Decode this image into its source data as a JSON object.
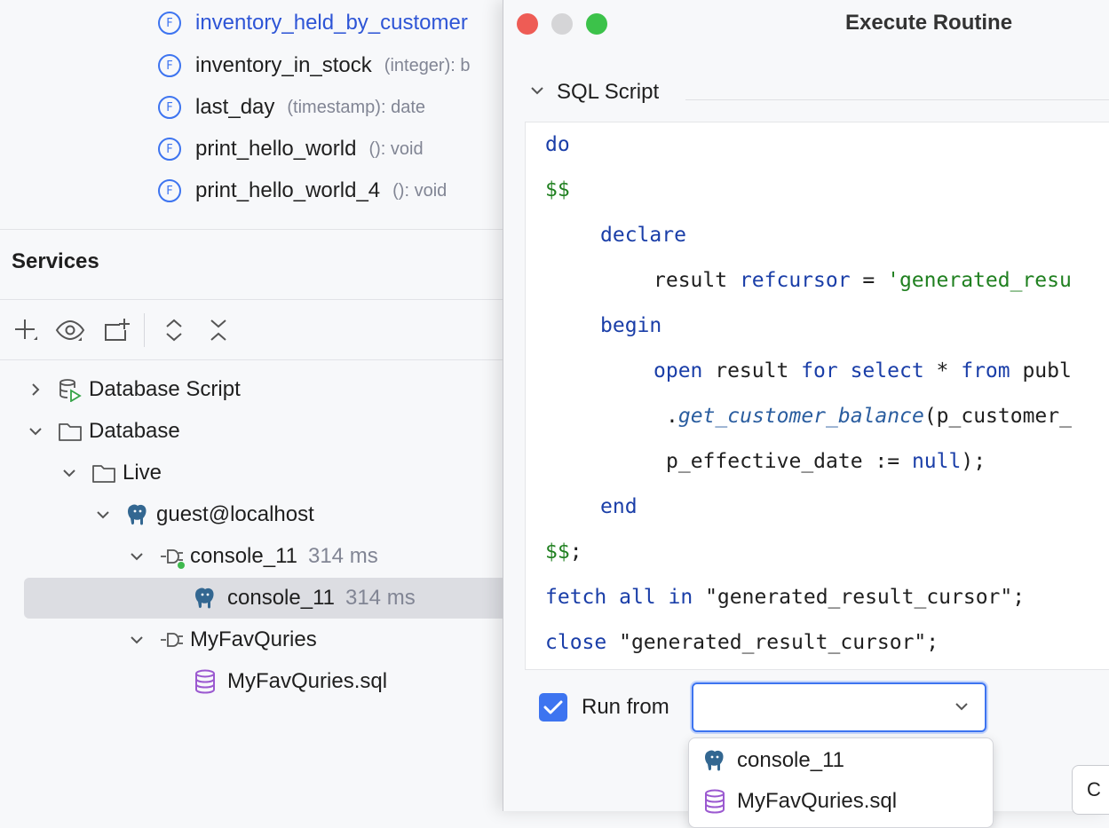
{
  "routines": [
    {
      "name": "inventory_held_by_customer",
      "signature": ""
    },
    {
      "name": "inventory_in_stock",
      "signature": "(integer): b"
    },
    {
      "name": "last_day",
      "signature": "(timestamp): date"
    },
    {
      "name": "print_hello_world",
      "signature": "(): void"
    },
    {
      "name": "print_hello_world_4",
      "signature": "(): void"
    }
  ],
  "routine_icon_letter": "F",
  "services": {
    "title": "Services",
    "toolbar_icons": [
      "add-icon",
      "eye-icon",
      "new-tab-icon",
      "expand-all-icon",
      "collapse-all-icon"
    ],
    "tree": [
      {
        "label": "Database Script",
        "meta": "",
        "icon": "database-script-icon"
      },
      {
        "label": "Database",
        "meta": "",
        "icon": "folder-icon"
      },
      {
        "label": "Live",
        "meta": "",
        "icon": "folder-icon"
      },
      {
        "label": "guest@localhost",
        "meta": "",
        "icon": "postgresql-icon"
      },
      {
        "label": "console_11",
        "meta": "314 ms",
        "icon": "session-icon"
      },
      {
        "label": "console_11",
        "meta": "314 ms",
        "icon": "postgresql-icon"
      },
      {
        "label": "MyFavQuries",
        "meta": "",
        "icon": "session-icon"
      },
      {
        "label": "MyFavQuries.sql",
        "meta": "",
        "icon": "sql-file-icon"
      }
    ]
  },
  "dialog": {
    "title": "Execute Routine",
    "section_title": "SQL Script",
    "code": {
      "l1": "do",
      "l2": "$$",
      "l3": "declare",
      "l4_a": "result ",
      "l4_b": "refcursor",
      "l4_c": " = ",
      "l4_d": "'generated_resu",
      "l5": "begin",
      "l6_a": "open",
      "l6_b": " result ",
      "l6_c": "for",
      "l6_d": " ",
      "l6_e": "select",
      "l6_f": " * ",
      "l6_g": "from",
      "l6_h": " publ",
      "l7_a": ".",
      "l7_b": "get_customer_balance",
      "l7_c": "(p_customer_",
      "l8_a": "p_effective_date := ",
      "l8_b": "null",
      "l8_c": ");",
      "l9": "end",
      "l10_a": "$$",
      "l10_b": ";",
      "l11_a": "fetch",
      "l11_b": " ",
      "l11_c": "all",
      "l11_d": " ",
      "l11_e": "in",
      "l11_f": " \"generated_result_cursor\";",
      "l12_a": "close",
      "l12_b": " \"generated_result_cursor\";"
    },
    "run_from_label": "Run from",
    "run_from_checked": true,
    "run_from_value": "",
    "dropdown_options": [
      {
        "label": "console_11",
        "icon": "postgresql-icon"
      },
      {
        "label": "MyFavQuries.sql",
        "icon": "sql-file-icon"
      }
    ],
    "ok_label": "C"
  },
  "colors": {
    "accent": "#3d74f0",
    "keyword": "#1a3ea8",
    "dollar_quote": "#208020",
    "close_light": "#ee5c55",
    "minimize_light": "#d5d5d7",
    "zoom_light": "#3cc24a"
  }
}
